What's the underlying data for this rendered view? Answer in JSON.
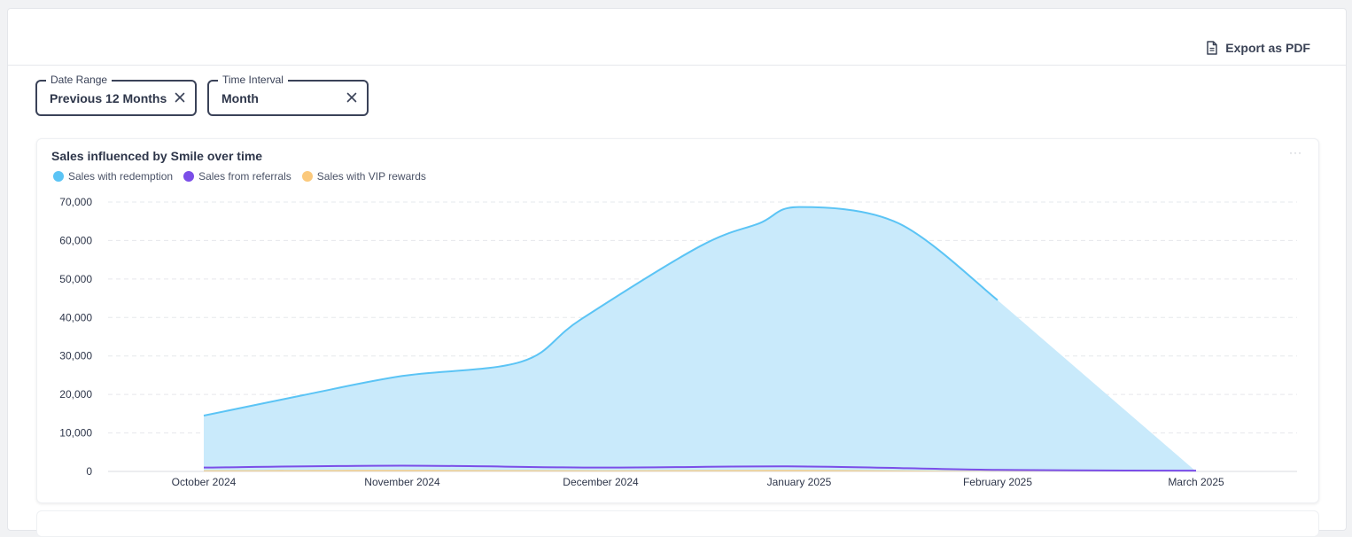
{
  "toolbar": {
    "export_label": "Export as PDF",
    "export_icon": "document-icon"
  },
  "filters": [
    {
      "label": "Date Range",
      "value": "Previous 12 Months"
    },
    {
      "label": "Time Interval",
      "value": "Month"
    }
  ],
  "chart_card": {
    "more_label": "···"
  },
  "colors": {
    "redemption_fill": "#c9eafb",
    "redemption_line": "#5bc4f5",
    "referrals_line": "#7b4ee8",
    "vip_fill": "#fbc97c",
    "grid": "#e6e8ec",
    "text": "#2e364a"
  },
  "chart_data": {
    "type": "area",
    "title": "Sales influenced by Smile over time",
    "categories": [
      "October 2024",
      "November 2024",
      "December 2024",
      "January 2025",
      "February 2025",
      "March 2025"
    ],
    "ylim": [
      0,
      70000
    ],
    "yticks": [
      0,
      10000,
      20000,
      30000,
      40000,
      50000,
      60000,
      70000
    ],
    "ytick_labels": [
      "0",
      "10,000",
      "20,000",
      "30,000",
      "40,000",
      "50,000",
      "60,000",
      "70,000"
    ],
    "grid": true,
    "legend_position": "top-left",
    "series": [
      {
        "name": "Sales with redemption",
        "color": "#5bc4f5",
        "x": [
          "October 2024",
          "October 2024",
          "November 2024",
          "December 2024",
          "December 2024",
          "January 2025",
          "January 2025",
          "February 2025",
          "February 2025",
          "March 2025"
        ],
        "values": [
          14500,
          19800,
          24800,
          28500,
          39500,
          58500,
          64500,
          68700,
          64500,
          44500
        ],
        "positions": [
          0,
          0.5,
          1,
          1.6,
          1.9,
          2.5,
          2.8,
          3.0,
          3.5,
          4.0
        ]
      },
      {
        "name": "Sales from referrals",
        "color": "#7b4ee8",
        "values": [
          1000,
          1500,
          1000,
          1300,
          400,
          200
        ]
      },
      {
        "name": "Sales with VIP rewards",
        "color": "#fbc97c",
        "values": [
          300,
          400,
          300,
          400,
          100,
          50
        ]
      }
    ]
  }
}
